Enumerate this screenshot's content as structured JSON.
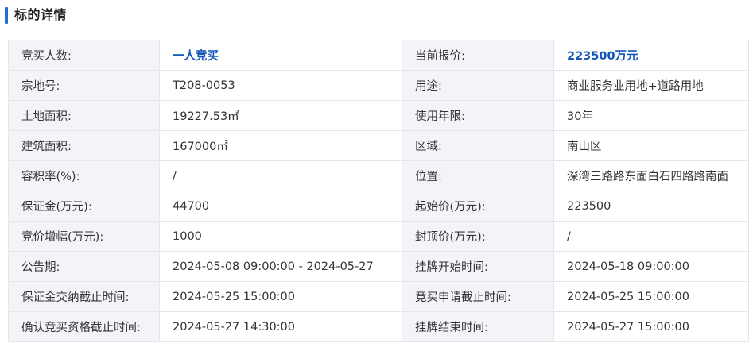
{
  "colors": {
    "accent": "#1f6fd6",
    "highlight": "#1457b8",
    "label_bg": "#f2f4f7",
    "border": "#e4e6ea"
  },
  "section": {
    "title": "标的详情"
  },
  "rows": [
    {
      "l1": "竞买人数:",
      "v1": "一人竞买",
      "l2": "当前报价:",
      "v2": "223500万元"
    },
    {
      "l1": "宗地号:",
      "v1": "T208-0053",
      "l2": "用途:",
      "v2": "商业服务业用地+道路用地"
    },
    {
      "l1": "土地面积:",
      "v1": "19227.53㎡",
      "l2": "使用年限:",
      "v2": "30年"
    },
    {
      "l1": "建筑面积:",
      "v1": "167000㎡",
      "l2": "区域:",
      "v2": "南山区"
    },
    {
      "l1": "容积率(%):",
      "v1": "/",
      "l2": "位置:",
      "v2": "深湾三路路东面白石四路路南面"
    },
    {
      "l1": "保证金(万元):",
      "v1": "44700",
      "l2": "起始价(万元):",
      "v2": "223500"
    },
    {
      "l1": "竞价增幅(万元):",
      "v1": "1000",
      "l2": "封顶价(万元):",
      "v2": "/"
    },
    {
      "l1": "公告期:",
      "v1": "2024-05-08 09:00:00 - 2024-05-27",
      "l2": "挂牌开始时间:",
      "v2": "2024-05-18 09:00:00"
    },
    {
      "l1": "保证金交纳截止时间:",
      "v1": "2024-05-25 15:00:00",
      "l2": "竞买申请截止时间:",
      "v2": "2024-05-25 15:00:00"
    },
    {
      "l1": "确认竞买资格截止时间:",
      "v1": "2024-05-27 14:30:00",
      "l2": "挂牌结束时间:",
      "v2": "2024-05-27 15:00:00"
    }
  ]
}
